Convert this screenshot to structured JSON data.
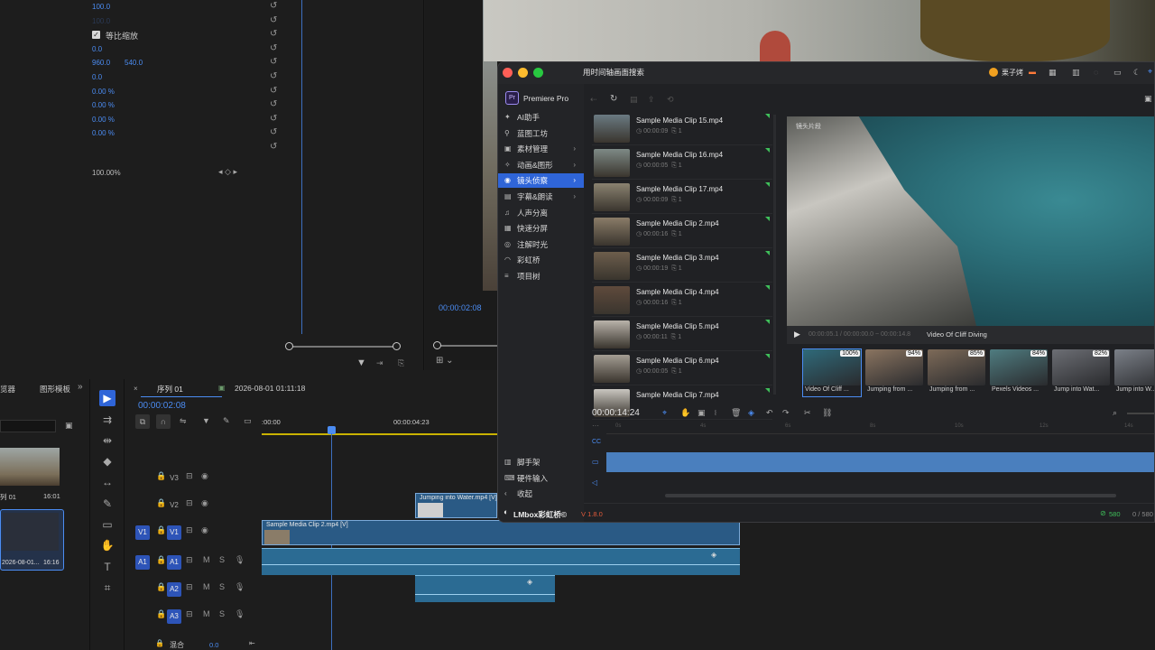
{
  "effects": {
    "rows": [
      {
        "value": "100.0",
        "value2": ""
      },
      {
        "value": "100.0",
        "value2": ""
      },
      {
        "label": "等比缩放",
        "checked": true
      },
      {
        "value": "0.0",
        "value2": ""
      },
      {
        "value": "960.0",
        "value2": "540.0"
      },
      {
        "value": "0.0",
        "value2": ""
      },
      {
        "value": "0.00 %",
        "value2": ""
      },
      {
        "value": "0.00 %",
        "value2": ""
      },
      {
        "value": "0.00 %",
        "value2": ""
      },
      {
        "value": "0.00 %",
        "value2": ""
      }
    ],
    "opacity": "100.00%"
  },
  "program": {
    "timecode": "00:00:02:08"
  },
  "project_panel": {
    "tab1": "览器",
    "tab2": "图形模板",
    "item1_label": "列 01",
    "item1_duration": "16:01",
    "item2_label": "2026-08-01...",
    "item2_duration": "16:16"
  },
  "timeline": {
    "tab_name": "序列 01",
    "tab2_name": "2026-08-01 01:11:18",
    "timecode": "00:00:02:08",
    "ruler_start": ":00:00",
    "ruler_mid": "00:00:04:23",
    "tracks": [
      {
        "id": "V3",
        "type": "video"
      },
      {
        "id": "V2",
        "type": "video"
      },
      {
        "id": "V1",
        "type": "video",
        "src": "V1"
      },
      {
        "id": "A1",
        "type": "audio",
        "src": "A1"
      },
      {
        "id": "A2",
        "type": "audio"
      },
      {
        "id": "A3",
        "type": "audio"
      }
    ],
    "mix_label": "混合",
    "mix_value": "0.0",
    "clip_v1": "Sample Media Clip 2.mp4 [V]",
    "clip_v2": "Jumping into Water.mp4 [V]"
  },
  "lmbox": {
    "title": "用时间轴画面搜索",
    "app_name": "Premiere Pro",
    "user_name": "栗子烤",
    "sidebar": [
      {
        "icon": "✦",
        "label": "AI助手"
      },
      {
        "icon": "⚲",
        "label": "蓝图工坊"
      },
      {
        "icon": "▣",
        "label": "素材管理",
        "arrow": true
      },
      {
        "icon": "✧",
        "label": "动画&图形",
        "arrow": true
      },
      {
        "icon": "◉",
        "label": "镜头侦察",
        "arrow": true,
        "active": true
      },
      {
        "icon": "▤",
        "label": "字幕&朗读",
        "arrow": true
      },
      {
        "icon": "♫",
        "label": "人声分离"
      },
      {
        "icon": "▦",
        "label": "快速分屏"
      },
      {
        "icon": "◎",
        "label": "注解时光"
      },
      {
        "icon": "◠",
        "label": "彩虹桥"
      },
      {
        "icon": "≡",
        "label": "项目树"
      }
    ],
    "sidebar_bottom": [
      {
        "icon": "▥",
        "label": "脚手架"
      },
      {
        "icon": "⌨",
        "label": "硬件输入"
      },
      {
        "icon": "‹",
        "label": "收起"
      }
    ],
    "brand": "LMbox彩虹桥©",
    "version": "V 1.8.0",
    "clips": [
      {
        "name": "Sample Media Clip 15.mp4",
        "duration": "00:00:09",
        "count": "1",
        "tone": "#6a7a82"
      },
      {
        "name": "Sample Media Clip 16.mp4",
        "duration": "00:00:05",
        "count": "1",
        "tone": "#7e8a86"
      },
      {
        "name": "Sample Media Clip 17.mp4",
        "duration": "00:00:09",
        "count": "1",
        "tone": "#8a8270"
      },
      {
        "name": "Sample Media Clip 2.mp4",
        "duration": "00:00:16",
        "count": "1",
        "tone": "#8a7c68"
      },
      {
        "name": "Sample Media Clip 3.mp4",
        "duration": "00:00:19",
        "count": "1",
        "tone": "#6d5e4c"
      },
      {
        "name": "Sample Media Clip 4.mp4",
        "duration": "00:00:16",
        "count": "1",
        "tone": "#5f4a3c"
      },
      {
        "name": "Sample Media Clip 5.mp4",
        "duration": "00:00:11",
        "count": "1",
        "tone": "#b9b3aa"
      },
      {
        "name": "Sample Media Clip 6.mp4",
        "duration": "00:00:05",
        "count": "1",
        "tone": "#a49d93"
      },
      {
        "name": "Sample Media Clip 7.mp4",
        "duration": "",
        "count": "",
        "tone": "#c9c6c0"
      }
    ],
    "preview_label": "镜头片段",
    "preview_time": "00:00:05.1 / 00:00:00.0 ~ 00:00:14.8",
    "preview_title": "Video Of Cliff Diving",
    "results": [
      {
        "name": "Video Of Cliff ...",
        "pct": "100%",
        "tone": "#2f6a7a"
      },
      {
        "name": "Jumping from ...",
        "pct": "94%",
        "tone": "#8a7460"
      },
      {
        "name": "Jumping from ...",
        "pct": "85%",
        "tone": "#7d6a58"
      },
      {
        "name": "Pexels Videos ...",
        "pct": "84%",
        "tone": "#4f7c80"
      },
      {
        "name": "Jump into Wat...",
        "pct": "82%",
        "tone": "#6c6e74"
      },
      {
        "name": "Jump into W...",
        "pct": "",
        "tone": "#7b8088"
      }
    ],
    "timeline_timecode": "00:00:14:24",
    "ruler_ticks": [
      "0s",
      "4s",
      "6s",
      "8s",
      "10s",
      "12s",
      "14s"
    ],
    "status": "580",
    "status2": "0 / 580"
  },
  "colors": {
    "accent": "#2f65d8",
    "timeline_blue": "#4a7fbe",
    "green": "#3fbf5a"
  }
}
